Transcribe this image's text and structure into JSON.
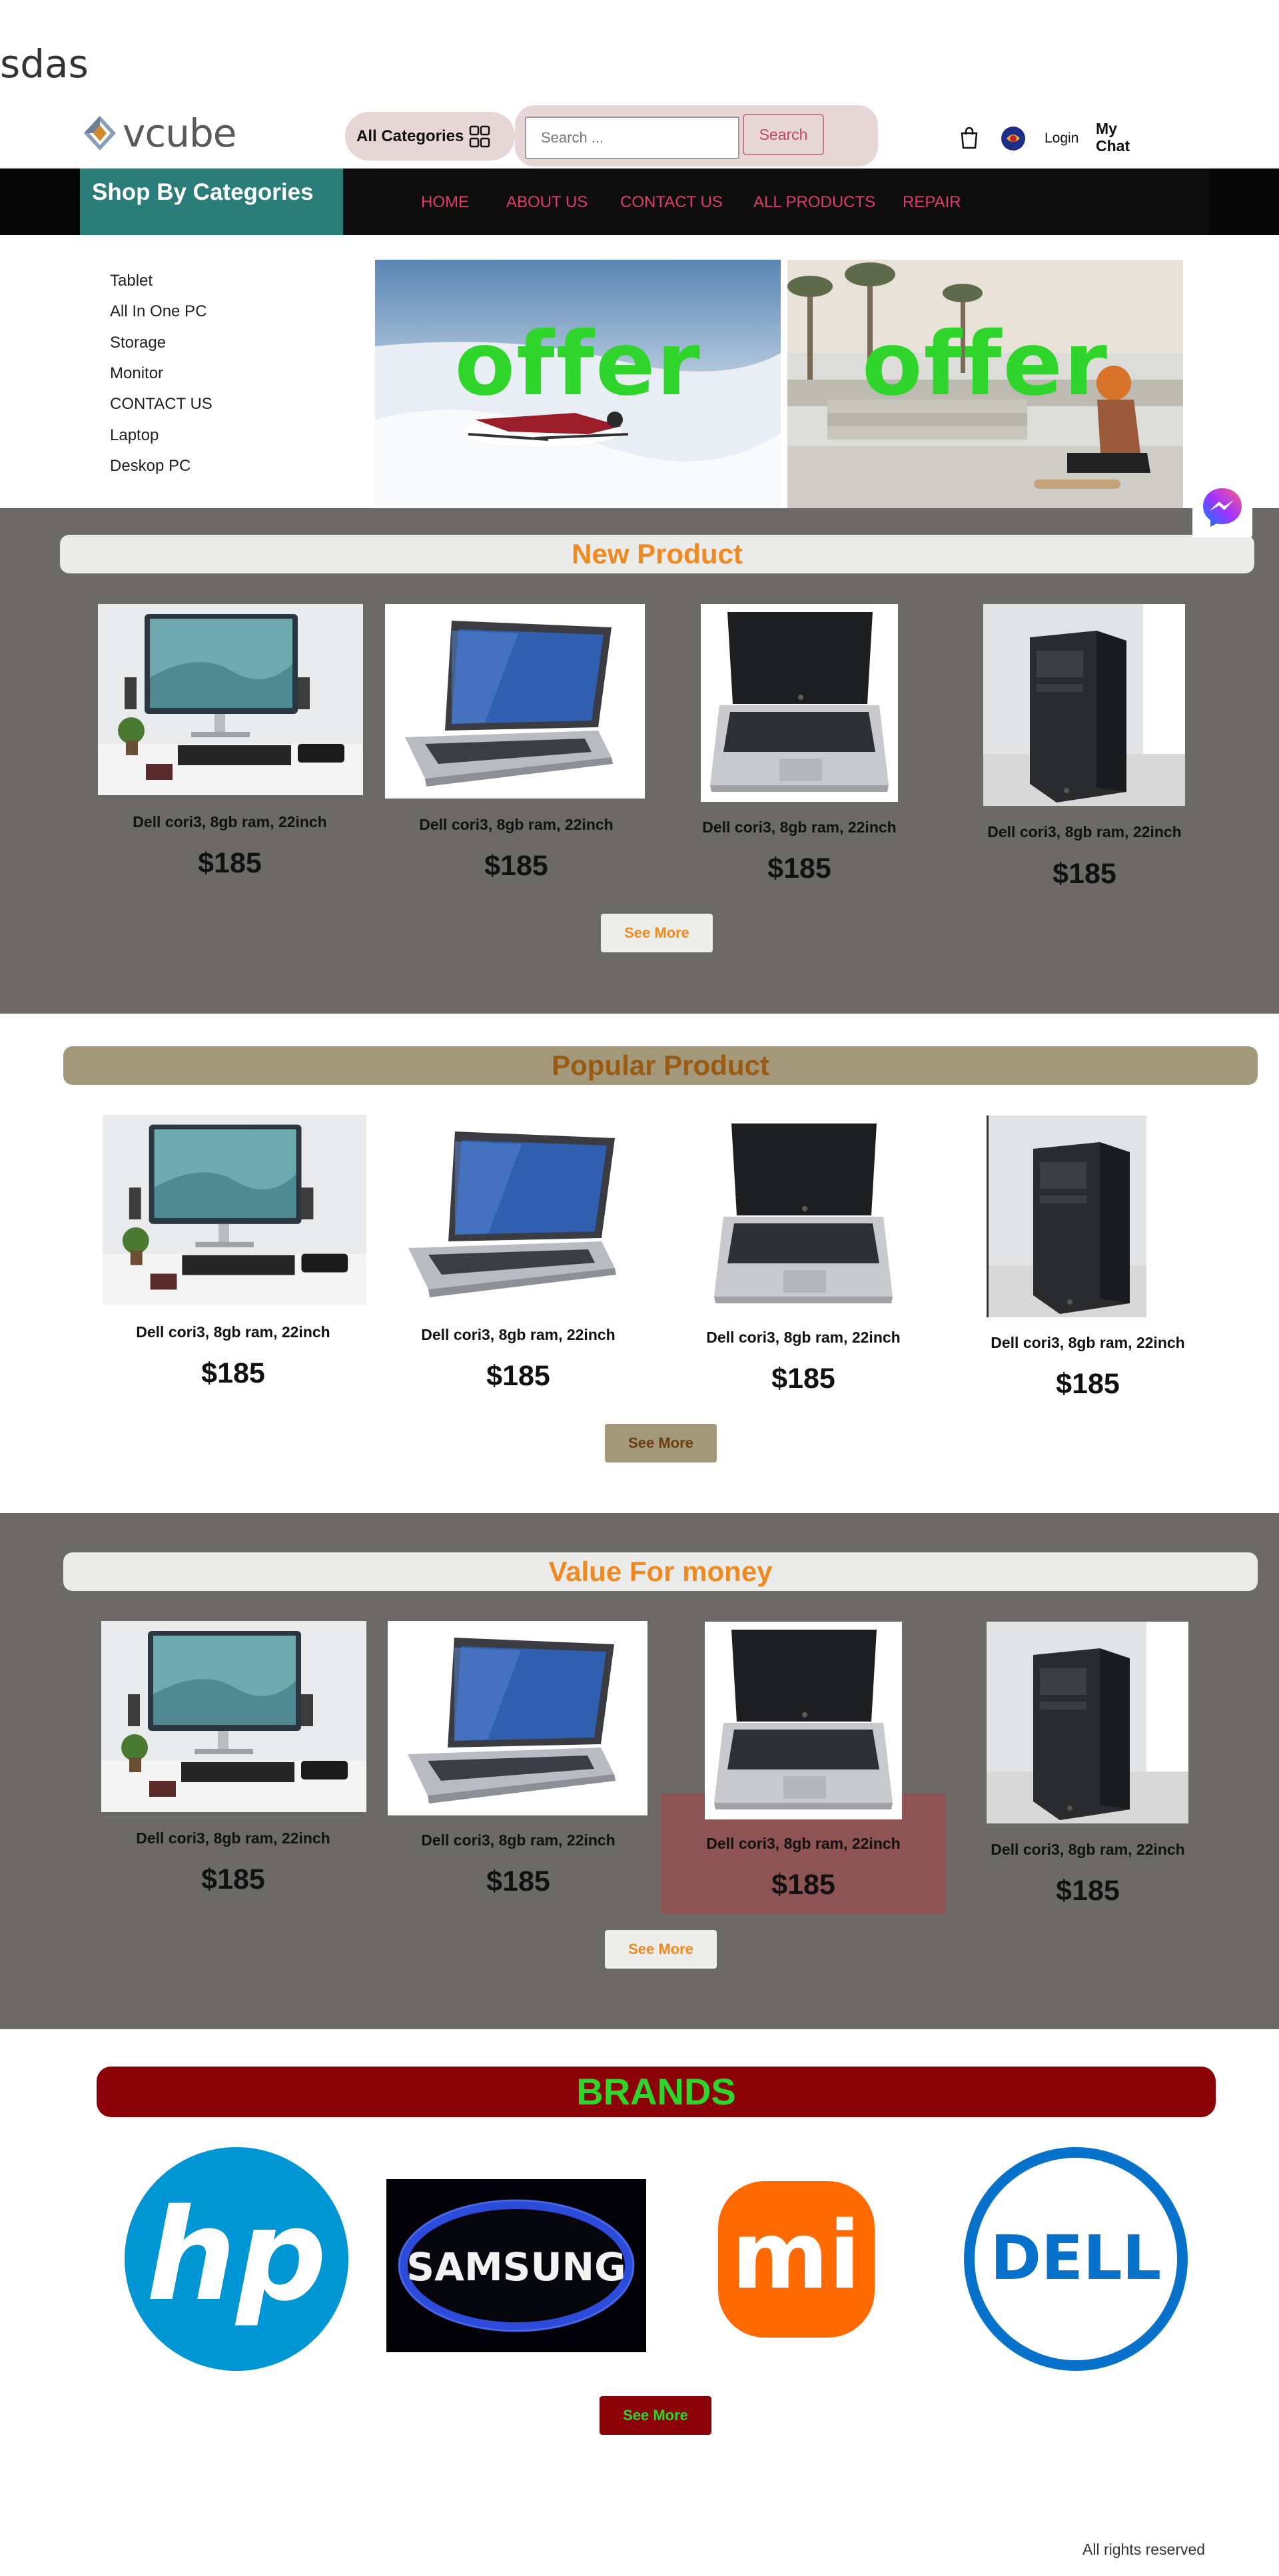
{
  "page": {
    "top_text": "sdas"
  },
  "header": {
    "logo_text": "vcube",
    "all_categories": "All Categories",
    "search_placeholder": "Search ...",
    "search_button": "Search",
    "login": "Login",
    "my_chat_line1": "My",
    "my_chat_line2": "Chat"
  },
  "nav": {
    "shop_by_categories": "Shop By Categories",
    "links": [
      "HOME",
      "ABOUT US",
      "CONTACT US",
      "ALL PRODUCTS",
      "REPAIR"
    ]
  },
  "sidebar": {
    "items": [
      "Tablet",
      "All In One PC",
      "Storage",
      "Monitor",
      "CONTACT US",
      "Laptop",
      "Deskop PC"
    ]
  },
  "banners": {
    "offer_1": "offer",
    "offer_2": "offer"
  },
  "sections": [
    {
      "title": "New Product",
      "see_more": "See More",
      "products": [
        {
          "name": "Dell cori3, 8gb ram, 22inch",
          "price": "$185"
        },
        {
          "name": "Dell cori3, 8gb ram, 22inch",
          "price": "$185"
        },
        {
          "name": "Dell cori3, 8gb ram, 22inch",
          "price": "$185"
        },
        {
          "name": "Dell cori3, 8gb ram, 22inch",
          "price": "$185"
        }
      ]
    },
    {
      "title": "Popular Product",
      "see_more": "See More",
      "products": [
        {
          "name": "Dell cori3, 8gb ram, 22inch",
          "price": "$185"
        },
        {
          "name": "Dell cori3, 8gb ram, 22inch",
          "price": "$185"
        },
        {
          "name": "Dell cori3, 8gb ram, 22inch",
          "price": "$185"
        },
        {
          "name": "Dell cori3, 8gb ram, 22inch",
          "price": "$185"
        }
      ]
    },
    {
      "title": "Value For money",
      "see_more": "See More",
      "products": [
        {
          "name": "Dell cori3, 8gb ram, 22inch",
          "price": "$185"
        },
        {
          "name": "Dell cori3, 8gb ram, 22inch",
          "price": "$185"
        },
        {
          "name": "Dell cori3, 8gb ram, 22inch",
          "price": "$185"
        },
        {
          "name": "Dell cori3, 8gb ram, 22inch",
          "price": "$185"
        }
      ]
    }
  ],
  "brands": {
    "title": "BRANDS",
    "logos": [
      "hp",
      "SAMSUNG",
      "mi",
      "DELL"
    ],
    "see_more": "See More"
  },
  "footer": {
    "text": "All rights reserved"
  },
  "colors": {
    "nav_link": "#e03c68",
    "shop_cat_bg": "#2a7d78",
    "section_grey": "#6b6a67",
    "new_title": "#f08a20",
    "popular_bar": "#a3987a",
    "popular_title": "#9a5a10",
    "brands_bar": "#8b0308",
    "brands_text": "#2fd52a",
    "offer_text": "#2fd52a"
  }
}
